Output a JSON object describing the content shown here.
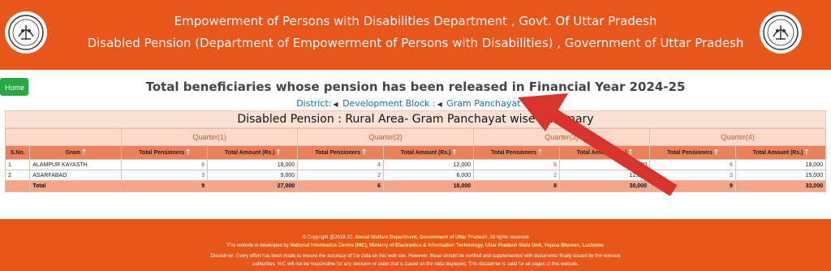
{
  "header": {
    "line1": "Empowerment of Persons with Disabilities Department , Govt. Of Uttar Pradesh",
    "line2": "Disabled Pension (Department of Empowerment of Persons with Disabilities) , Government of Uttar Pradesh"
  },
  "home_label": "Home",
  "main_title": "Total beneficiaries whose pension has been released in Financial Year 2024-25",
  "filters": {
    "district": "District:",
    "development_block": "Development Block :",
    "gram_panchayat": "Gram Panchayat :"
  },
  "table": {
    "title": "Disabled Pension : Rural Area- Gram Panchayat wise Summary",
    "quarters": [
      "Quarter(1)",
      "Quarter(2)",
      "Quarter(3)",
      "Quarter(4)"
    ],
    "columns": {
      "sno": "S.No.",
      "gram": "Gram",
      "total_pensioners": "Total Pensioners",
      "total_amount": "Total Amount (Rs.)"
    },
    "rows": [
      {
        "sno": "1",
        "gram": "ALAMPUR KAYASTH",
        "q1_p": "6",
        "q1_a": "18,000",
        "q2_p": "4",
        "q2_a": "12,000",
        "q3_p": "6",
        "q3_a": "18,000",
        "q4_p": "6",
        "q4_a": "18,000"
      },
      {
        "sno": "2",
        "gram": "ASARFABAD",
        "q1_p": "3",
        "q1_a": "9,000",
        "q2_p": "2",
        "q2_a": "6,000",
        "q3_p": "2",
        "q3_a": "12,000",
        "q4_p": "3",
        "q4_a": "15,000"
      }
    ],
    "total": {
      "label": "Total",
      "q1_p": "9",
      "q1_a": "27,000",
      "q2_p": "6",
      "q2_a": "18,000",
      "q3_p": "8",
      "q3_a": "30,000",
      "q4_p": "9",
      "q4_a": "33,000"
    }
  },
  "footer": {
    "copyright_prefix": "© Copyright @2019-20.",
    "copyright_org": "Social Welfare Department, Government of Uttar Pradesh",
    "copyright_suffix": ", All rights reserved",
    "dev_prefix": "This website is developed by",
    "dev_org": "National Informatics Centre (NIC), Ministry of Electronics & Information Technology, Uttar Pradesh State Unit, Yojana Bhawan, Lucknow.",
    "disclaimer1": "Disclaimer: Every effort has been made to ensure the accuracy of the data on this web site. However, these should be verified and supplemented with documents finally issued by the relevant",
    "disclaimer2": "authorities. NIC will not be responsible for any decision or claim that is based on the data displayed. This disclaimer is valid for all pages of this website."
  },
  "colors": {
    "header_bg": "#e8561a",
    "home_button": "#28a745",
    "arrow": "#d9342b",
    "link": "#1a6fb5"
  }
}
